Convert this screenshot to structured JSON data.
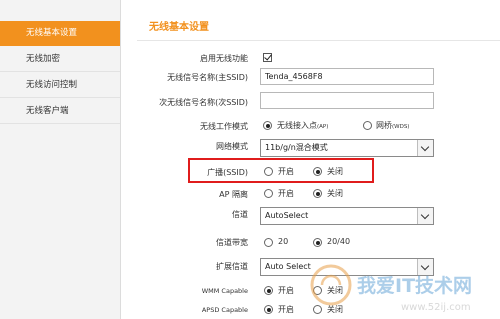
{
  "sidebar": {
    "items": [
      {
        "label": "无线基本设置",
        "active": true
      },
      {
        "label": "无线加密",
        "active": false
      },
      {
        "label": "无线访问控制",
        "active": false
      },
      {
        "label": "无线客户端",
        "active": false
      }
    ]
  },
  "main": {
    "section_title": "无线基本设置",
    "enable_wireless": {
      "label": "启用无线功能",
      "checked": true
    },
    "ssid_primary": {
      "label": "无线信号名称(主SSID)",
      "value": "Tenda_4568F8"
    },
    "ssid_secondary": {
      "label": "次无线信号名称(次SSID)",
      "value": ""
    },
    "work_mode": {
      "label": "无线工作模式",
      "options": [
        {
          "label": "无线接入点",
          "suffix": "(AP)",
          "selected": true
        },
        {
          "label": "网桥",
          "suffix": "(WDS)",
          "selected": false
        }
      ]
    },
    "network_mode": {
      "label": "网络模式",
      "selected": "11b/g/n混合模式"
    },
    "broadcast": {
      "label": "广播(SSID)",
      "options": [
        {
          "label": "开启",
          "selected": false
        },
        {
          "label": "关闭",
          "selected": true
        }
      ]
    },
    "ap_isolation": {
      "label": "AP 隔离",
      "options": [
        {
          "label": "开启",
          "selected": false
        },
        {
          "label": "关闭",
          "selected": true
        }
      ]
    },
    "channel": {
      "label": "信道",
      "selected": "AutoSelect"
    },
    "bandwidth": {
      "label": "信道带宽",
      "options": [
        {
          "label": "20",
          "selected": false
        },
        {
          "label": "20/40",
          "selected": true
        }
      ]
    },
    "ext_channel": {
      "label": "扩展信道",
      "selected": "Auto Select"
    },
    "wmm": {
      "label": "WMM Capable",
      "options": [
        {
          "label": "开启",
          "selected": true
        },
        {
          "label": "关闭",
          "selected": false
        }
      ]
    },
    "apsd": {
      "label": "APSD Capable",
      "options": [
        {
          "label": "开启",
          "selected": true
        },
        {
          "label": "关闭",
          "selected": false
        }
      ]
    }
  },
  "watermark": {
    "text": "我爱IT技术网",
    "url": "www.52ij.com"
  },
  "colors": {
    "accent": "#f2911e",
    "highlight": "#e01c1c"
  }
}
